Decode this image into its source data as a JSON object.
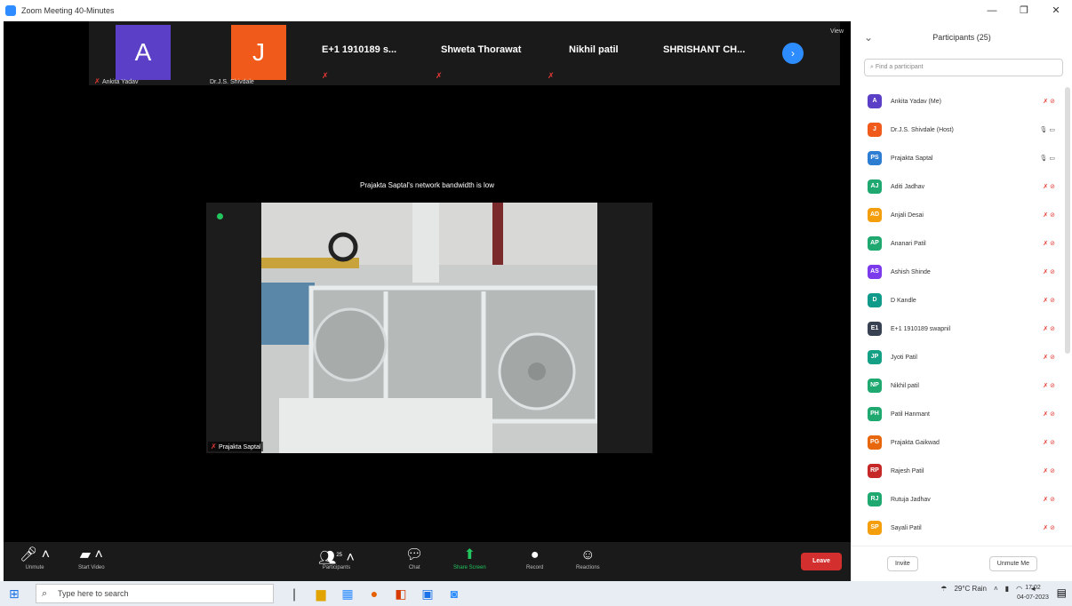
{
  "window": {
    "title": "Zoom Meeting 40-Minutes",
    "controls": [
      "—",
      "❐",
      "✕"
    ]
  },
  "strip": {
    "tiles": [
      {
        "initial": "A",
        "color": "#5b3fc6",
        "label": "Ankita Yadav"
      },
      {
        "initial": "J",
        "color": "#f05a1a",
        "label": "Dr.J.S. Shivdale"
      }
    ],
    "name_tiles": [
      "E+1 1910189 s...",
      "Shweta Thorawat",
      "Nikhil patil",
      "SHRISHANT CH..."
    ],
    "next_icon": "chevron-right-icon",
    "view_label": "View"
  },
  "main": {
    "bandwidth_msg": "Prajakta Saptal's network bandwidth is low",
    "speaker_name": "Prajakta Saptal"
  },
  "toolbar": {
    "unmute": "Unmute",
    "start_video": "Start Video",
    "participants": "Participants",
    "participants_count": "25",
    "chat": "Chat",
    "share_screen": "Share Screen",
    "record": "Record",
    "reactions": "Reactions",
    "leave": "Leave"
  },
  "panel": {
    "title": "Participants (25)",
    "search_placeholder": "Find a participant",
    "invite": "Invite",
    "unmute_me": "Unmute Me",
    "participants": [
      {
        "initials": "A",
        "name": "Ankita Yadav (Me)",
        "color": "#5b3fc6",
        "status": "muted"
      },
      {
        "initials": "J",
        "name": "Dr.J.S. Shivdale (Host)",
        "color": "#f05a1a",
        "status": "on"
      },
      {
        "initials": "PS",
        "name": "Prajakta Saptal",
        "color": "#2d7dd2",
        "status": "on"
      },
      {
        "initials": "AJ",
        "name": "Aditi Jadhav",
        "color": "#1fa971",
        "status": "muted"
      },
      {
        "initials": "AD",
        "name": "Anjali Desai",
        "color": "#f59e0b",
        "status": "muted"
      },
      {
        "initials": "AP",
        "name": "Ananari Patil",
        "color": "#1fa971",
        "status": "muted"
      },
      {
        "initials": "AS",
        "name": "Ashish Shinde",
        "color": "#7c3aed",
        "status": "muted"
      },
      {
        "initials": "D",
        "name": "D Kandle",
        "color": "#0f9a8a",
        "status": "muted"
      },
      {
        "initials": "E1",
        "name": "E+1 1910189 swapnil",
        "color": "#374151",
        "status": "muted"
      },
      {
        "initials": "JP",
        "name": "Jyoti Patil",
        "color": "#14a085",
        "status": "muted"
      },
      {
        "initials": "NP",
        "name": "Nikhil patil",
        "color": "#1fa971",
        "status": "muted"
      },
      {
        "initials": "PH",
        "name": "Patil Hanmant",
        "color": "#1fa971",
        "status": "muted"
      },
      {
        "initials": "PG",
        "name": "Prajakta Gaikwad",
        "color": "#e8660c",
        "status": "muted"
      },
      {
        "initials": "RP",
        "name": "Rajesh Patil",
        "color": "#c62828",
        "status": "muted"
      },
      {
        "initials": "RJ",
        "name": "Rutuja Jadhav",
        "color": "#1fa971",
        "status": "muted"
      },
      {
        "initials": "SP",
        "name": "Sayali Patil",
        "color": "#f59e0b",
        "status": "muted"
      }
    ]
  },
  "taskbar": {
    "search_placeholder": "Type here to search",
    "weather": "29°C Rain",
    "time": "17:02",
    "date": "04-07-2023"
  }
}
